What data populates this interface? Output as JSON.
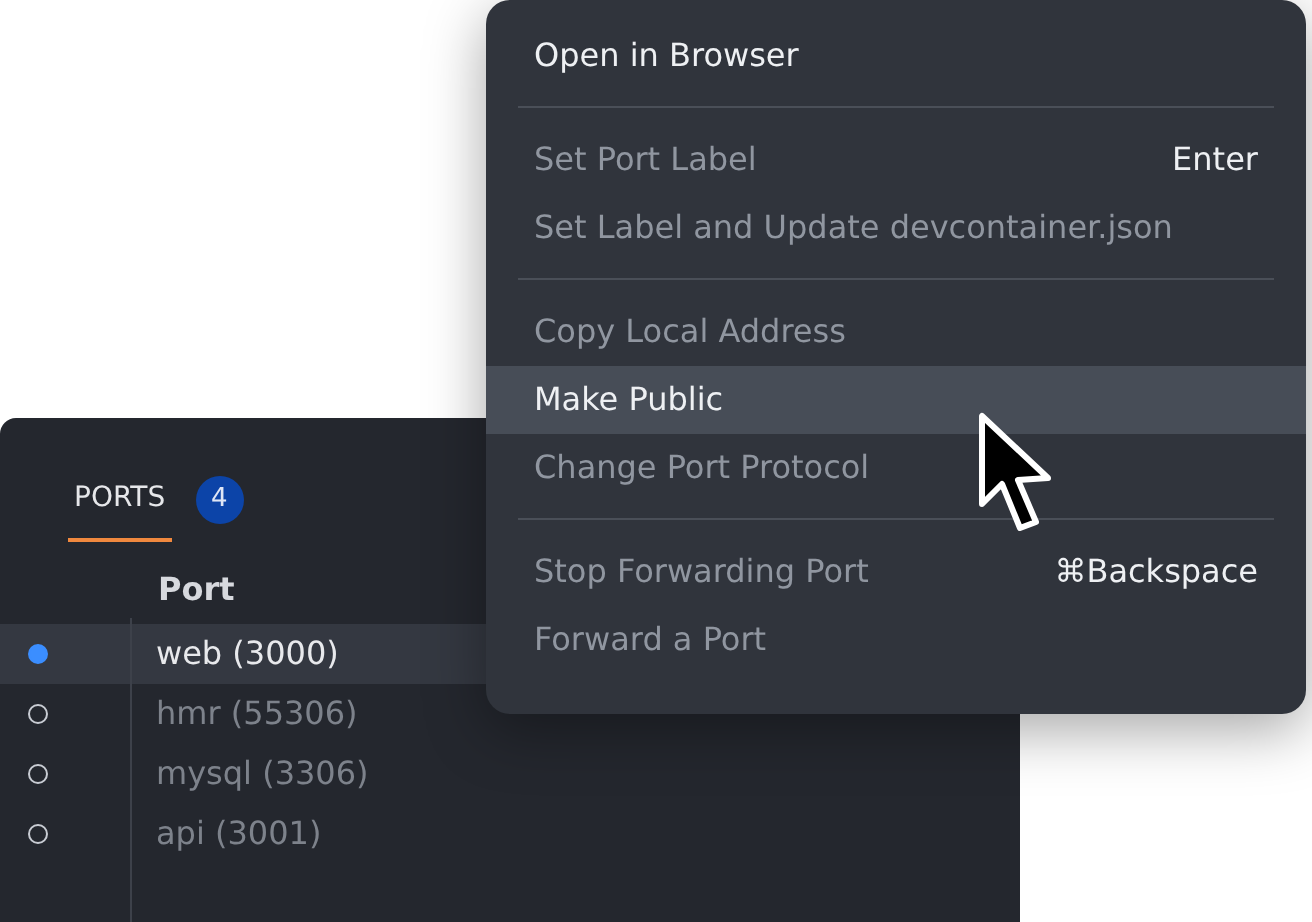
{
  "ports_panel": {
    "tab": {
      "label": "PORTS",
      "badge": "4",
      "selected": true
    },
    "column_header": "Port",
    "rows": [
      {
        "label": "web (3000)",
        "selected": true
      },
      {
        "label": "hmr (55306)",
        "selected": false
      },
      {
        "label": "mysql (3306)",
        "selected": false
      },
      {
        "label": "api (3001)",
        "selected": false
      }
    ]
  },
  "context_menu": {
    "items": [
      {
        "kind": "item",
        "label": "Open in Browser",
        "disabled": false,
        "selected": false
      },
      {
        "kind": "separator"
      },
      {
        "kind": "item",
        "label": "Set Port Label",
        "shortcut": "Enter",
        "disabled": true,
        "selected": false
      },
      {
        "kind": "item",
        "label": "Set Label and Update devcontainer.json",
        "disabled": true,
        "selected": false
      },
      {
        "kind": "separator"
      },
      {
        "kind": "item",
        "label": "Copy Local Address",
        "disabled": true,
        "selected": false
      },
      {
        "kind": "item",
        "label": "Make Public",
        "disabled": false,
        "selected": true
      },
      {
        "kind": "item",
        "label": "Change Port Protocol",
        "disabled": true,
        "selected": false
      },
      {
        "kind": "separator"
      },
      {
        "kind": "item",
        "label": "Stop Forwarding Port",
        "shortcut": "⌘Backspace",
        "disabled": true,
        "selected": false
      },
      {
        "kind": "item",
        "label": "Forward a Port",
        "disabled": true,
        "selected": false
      }
    ]
  }
}
